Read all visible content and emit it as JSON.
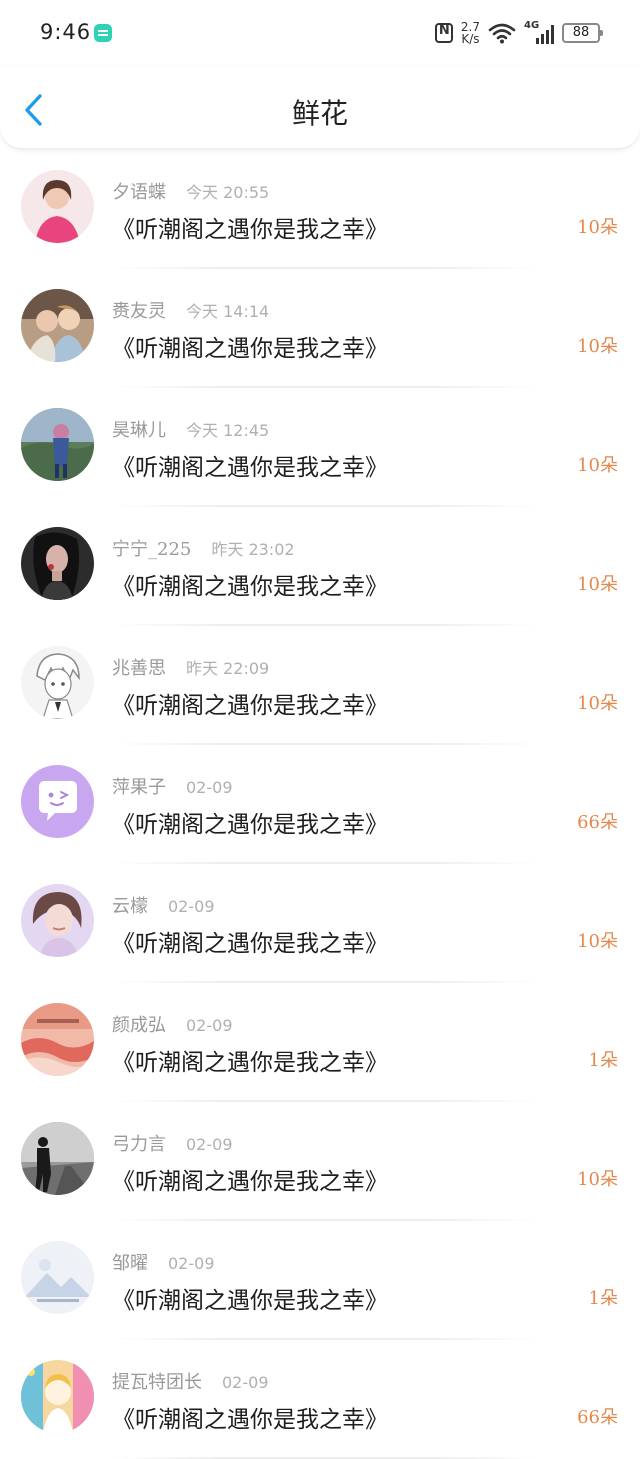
{
  "status_bar": {
    "time": "9:46",
    "net_speed_value": "2.7",
    "net_speed_unit": "K/s",
    "signal_label": "4G",
    "battery": "88"
  },
  "header": {
    "title": "鲜花"
  },
  "records": [
    {
      "name": "夕语蝶",
      "time": "今天 20:55",
      "title": "《听潮阁之遇你是我之幸》",
      "count": "10朵",
      "avatar_colors": [
        "#f6e7e8",
        "#e8447d"
      ]
    },
    {
      "name": "赉友灵",
      "time": "今天 14:14",
      "title": "《听潮阁之遇你是我之幸》",
      "count": "10朵",
      "avatar_colors": [
        "#b89c83",
        "#7c6350"
      ]
    },
    {
      "name": "昊琳儿",
      "time": "今天 12:45",
      "title": "《听潮阁之遇你是我之幸》",
      "count": "10朵",
      "avatar_colors": [
        "#7a8fb0",
        "#3e5e8f"
      ]
    },
    {
      "name": "宁宁_225",
      "time": "昨天 23:02",
      "title": "《听潮阁之遇你是我之幸》",
      "count": "10朵",
      "avatar_colors": [
        "#2c2c2c",
        "#c9a39a"
      ]
    },
    {
      "name": "兆善思",
      "time": "昨天 22:09",
      "title": "《听潮阁之遇你是我之幸》",
      "count": "10朵",
      "avatar_colors": [
        "#f0f0f0",
        "#8a8a8a"
      ]
    },
    {
      "name": "萍果子",
      "time": "02-09",
      "title": "《听潮阁之遇你是我之幸》",
      "count": "66朵",
      "avatar_colors": [
        "#c8a7f0",
        "#ffffff"
      ]
    },
    {
      "name": "云檬",
      "time": "02-09",
      "title": "《听潮阁之遇你是我之幸》",
      "count": "10朵",
      "avatar_colors": [
        "#e4d7f1",
        "#b48a90"
      ]
    },
    {
      "name": "颜成弘",
      "time": "02-09",
      "title": "《听潮阁之遇你是我之幸》",
      "count": "1朵",
      "avatar_colors": [
        "#f0b9a8",
        "#e0685c"
      ]
    },
    {
      "name": "弓力言",
      "time": "02-09",
      "title": "《听潮阁之遇你是我之幸》",
      "count": "10朵",
      "avatar_colors": [
        "#9a9a9a",
        "#333333"
      ]
    },
    {
      "name": "邹曜",
      "time": "02-09",
      "title": "《听潮阁之遇你是我之幸》",
      "count": "1朵",
      "avatar_colors": [
        "#eef1f6",
        "#c7d3e6"
      ]
    },
    {
      "name": "提瓦特团长",
      "time": "02-09",
      "title": "《听潮阁之遇你是我之幸》",
      "count": "66朵",
      "avatar_colors": [
        "#f6d7a0",
        "#6ec1d9"
      ]
    }
  ],
  "colors": {
    "accent_blue": "#1e9bea",
    "count_orange": "#e4884c"
  },
  "icons": {
    "back": "chevron-left-icon",
    "wifi": "wifi-icon",
    "nfc": "nfc-icon",
    "battery": "battery-icon",
    "signal": "cellular-signal-icon"
  }
}
